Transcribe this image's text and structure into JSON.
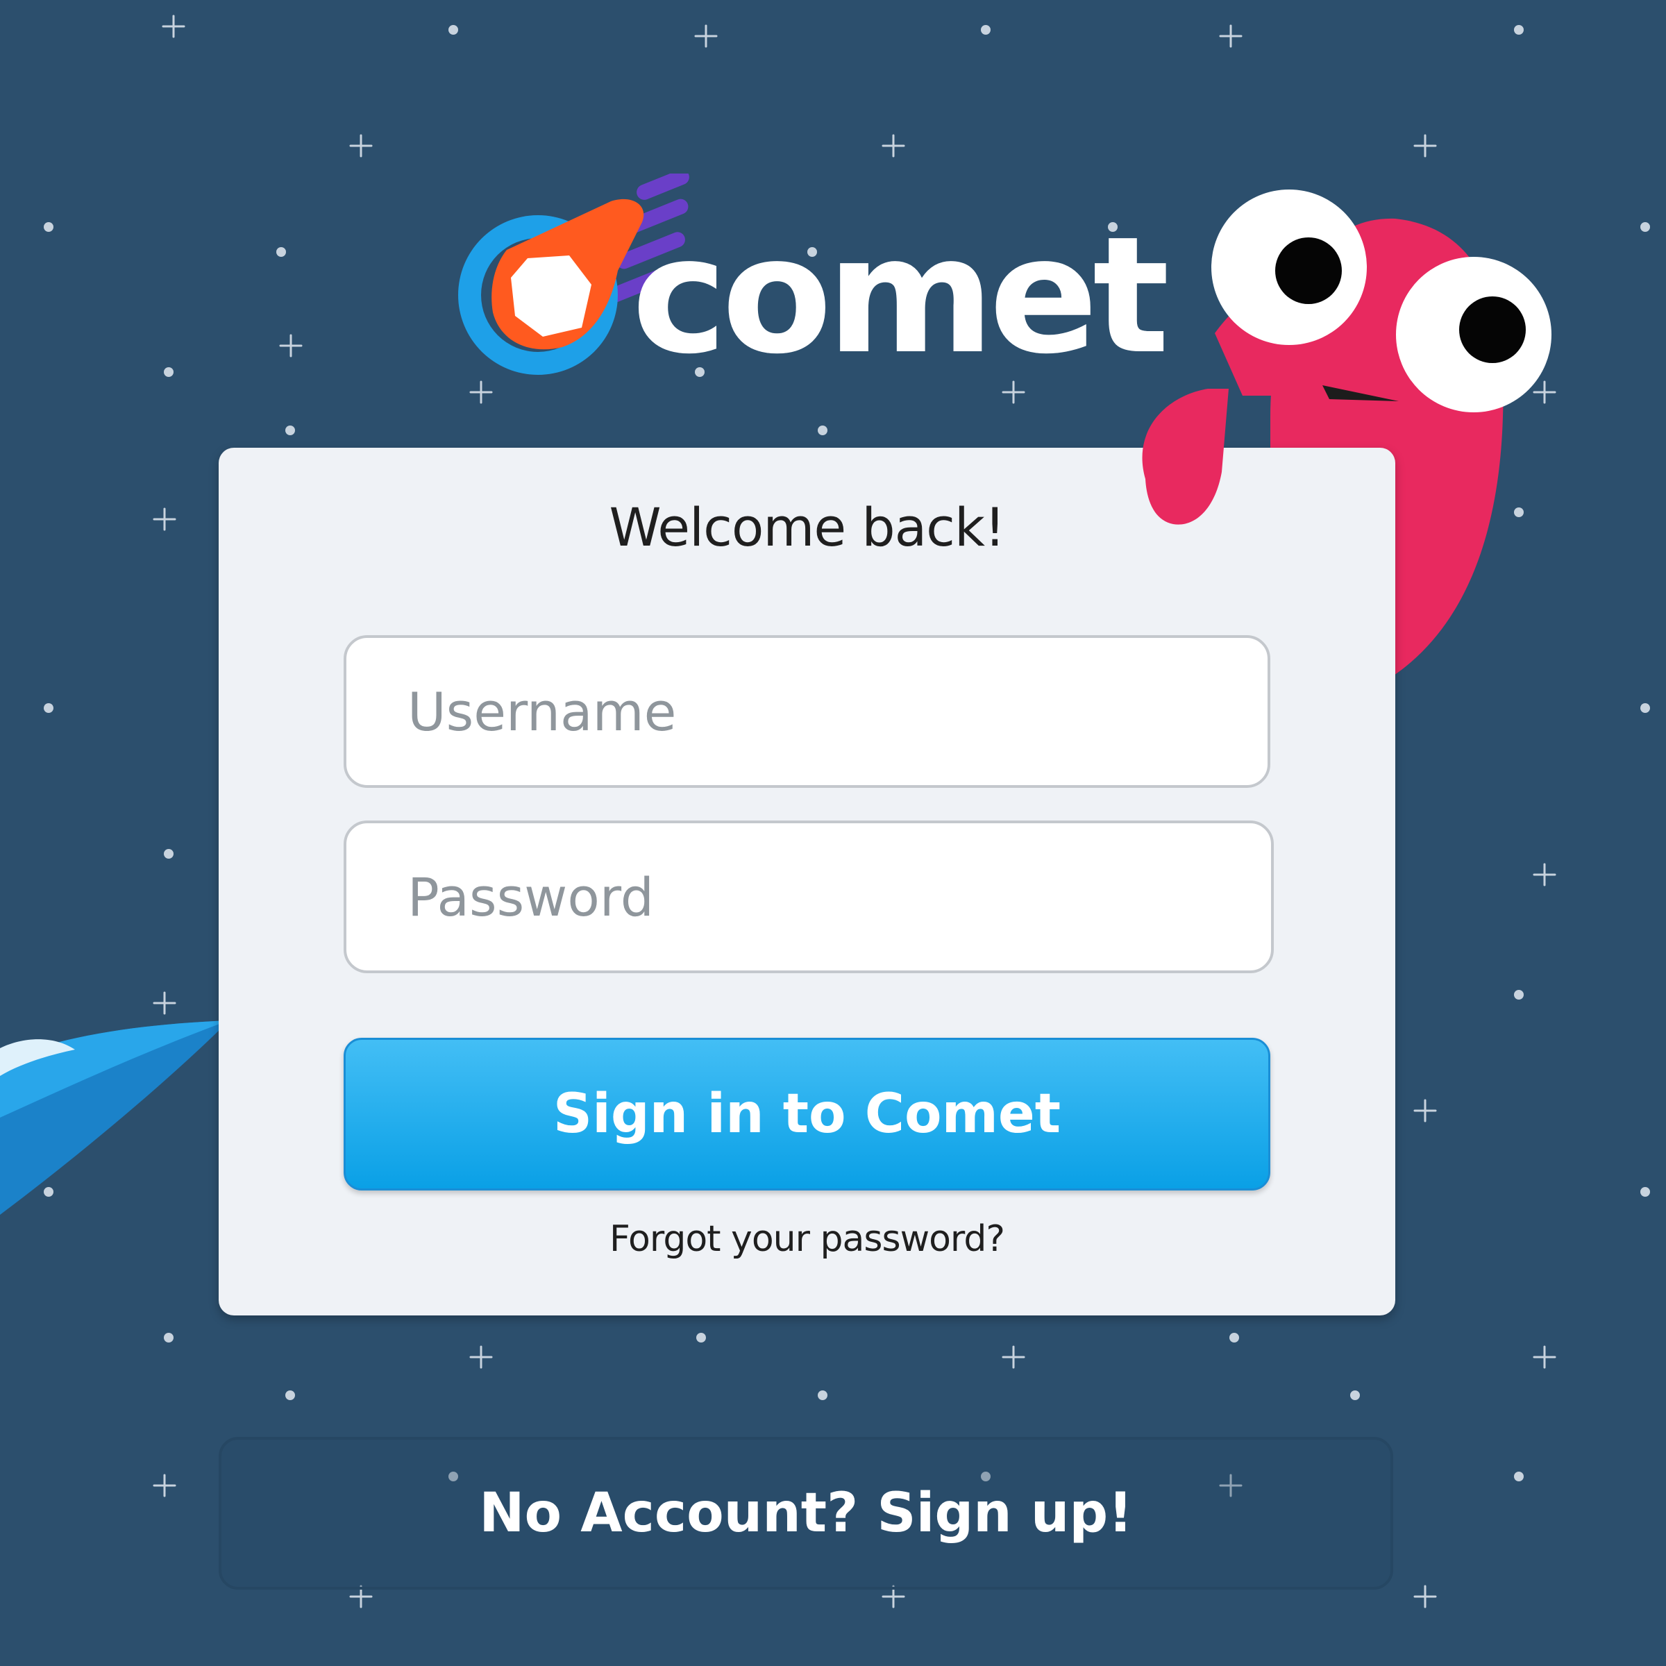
{
  "brand": {
    "name": "comet",
    "colors": {
      "background": "#2c4f6d",
      "card": "#eff2f6",
      "primary_button": "#1aa8ec",
      "monster": "#e8295f",
      "logo_ring": "#1ea0e8",
      "logo_orange": "#ff5a1f",
      "logo_purple": "#6a3fc8"
    }
  },
  "login": {
    "title": "Welcome back!",
    "username_placeholder": "Username",
    "username_value": "",
    "password_placeholder": "Password",
    "password_value": "",
    "submit_label": "Sign in to Comet",
    "forgot_label": "Forgot your password?"
  },
  "signup": {
    "label": "No Account? Sign up!"
  },
  "icons": {
    "logo": "comet-logo-icon",
    "mascot": "pink-monster-mascot",
    "rocket": "rocket-illustration",
    "stars": "star-field"
  }
}
